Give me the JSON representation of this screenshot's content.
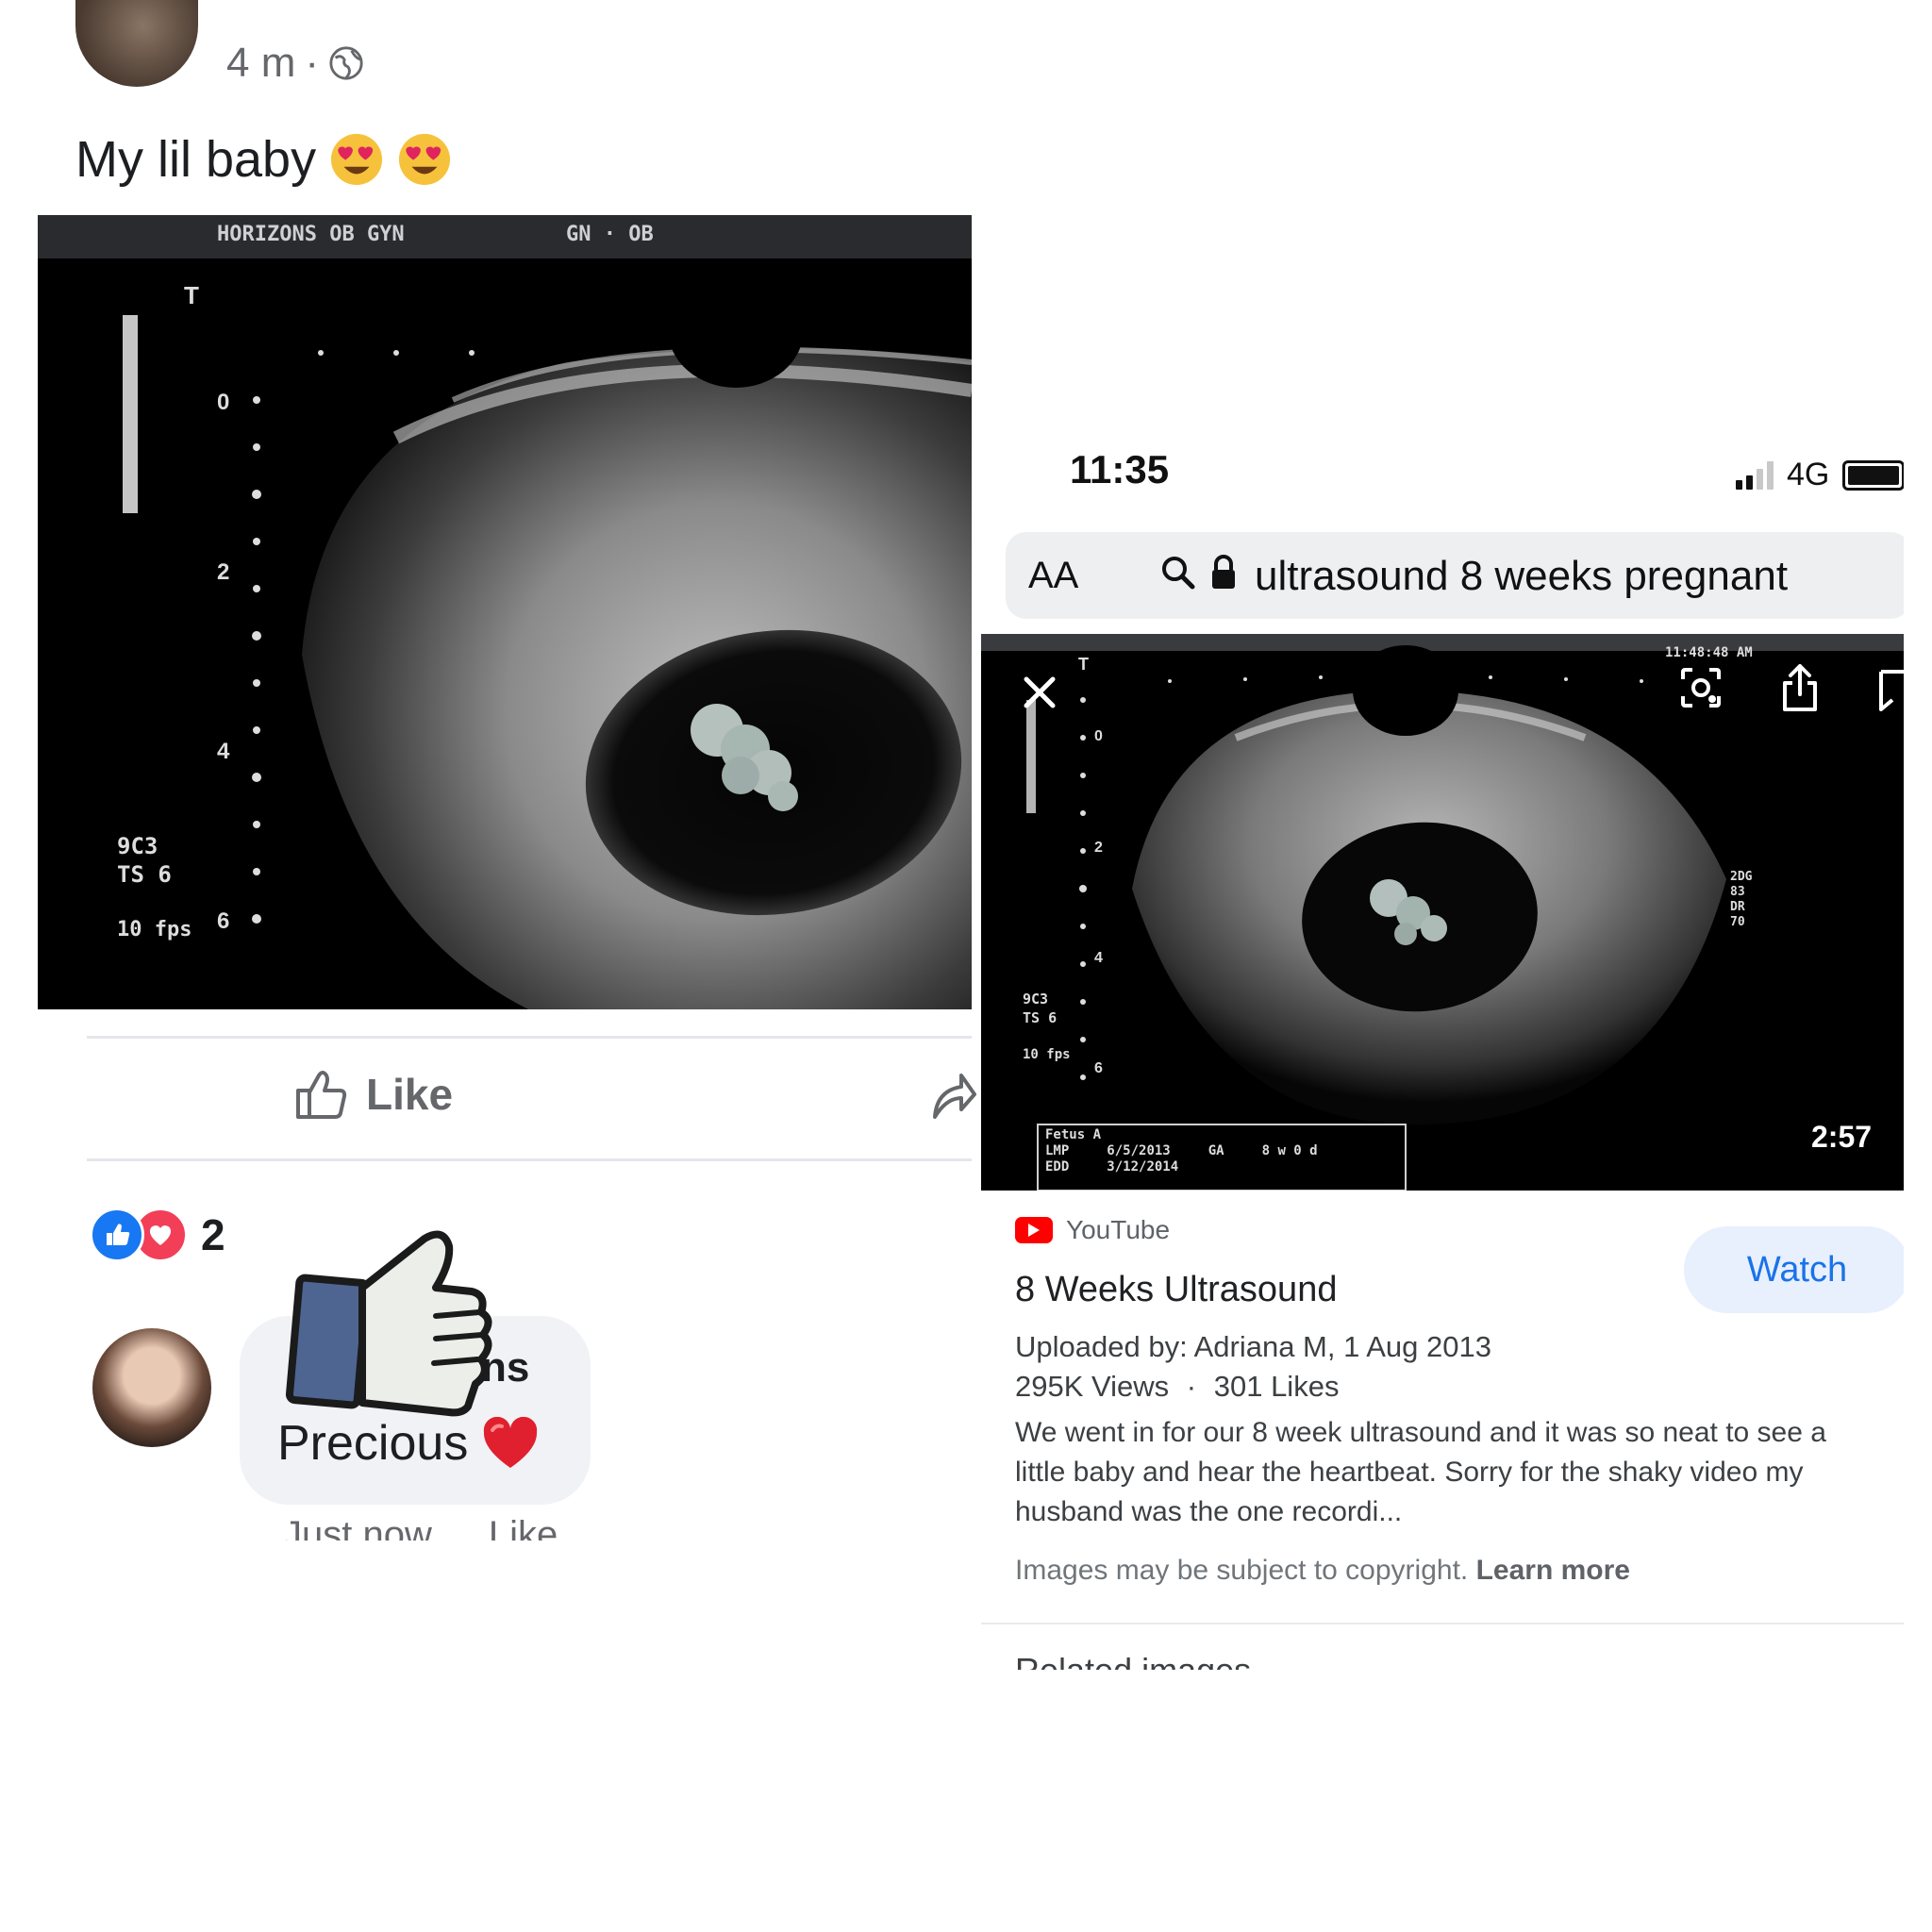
{
  "post": {
    "time": "4 m",
    "separator": "·",
    "caption": "My lil baby",
    "like_label": "Like",
    "reaction_count": "2",
    "comment": {
      "name_partial": "ns",
      "text": "Precious",
      "time": "Just now",
      "like": "Like"
    }
  },
  "ultrasound_left": {
    "header": "HORIZONS OB GYN",
    "mode": "GN · OB",
    "depth_top": "T",
    "scale_labels": [
      "0",
      "2",
      "4",
      "6"
    ],
    "side_labels": [
      "9C3",
      "TS 6",
      "10 fps"
    ]
  },
  "phone": {
    "time": "11:35",
    "network": "4G",
    "reader_label": "AA",
    "search_query": "ultrasound 8 weeks pregnant",
    "image_overlay": {
      "timestamp": "11:48:48 AM",
      "side_labels": [
        "9C3",
        "TS 6",
        "10 fps"
      ],
      "right_labels": [
        "2DG",
        "83",
        "DR",
        "70"
      ],
      "info_box": [
        "Fetus A",
        "LMP",
        "6/5/2013",
        "GA",
        "8 w 0 d",
        "EDD",
        "3/12/2014"
      ]
    },
    "duration": "2:57",
    "source": "YouTube",
    "title": "8 Weeks Ultrasound",
    "watch_label": "Watch",
    "uploaded": "Uploaded by: Adriana M, 1 Aug 2013",
    "views": "295K Views",
    "likes": "301 Likes",
    "description": "We went in for our 8 week ultrasound and it was so neat to see a little baby and hear the heartbeat. Sorry for the shaky video my husband was the one recordi...",
    "copyright_text": "Images may be subject to copyright.",
    "learn_more": "Learn more",
    "related": "Related images"
  },
  "colors": {
    "fb_blue": "#1877f2",
    "love_red": "#f33e58",
    "google_blue": "#1a73e8",
    "youtube_red": "#ff0000"
  }
}
